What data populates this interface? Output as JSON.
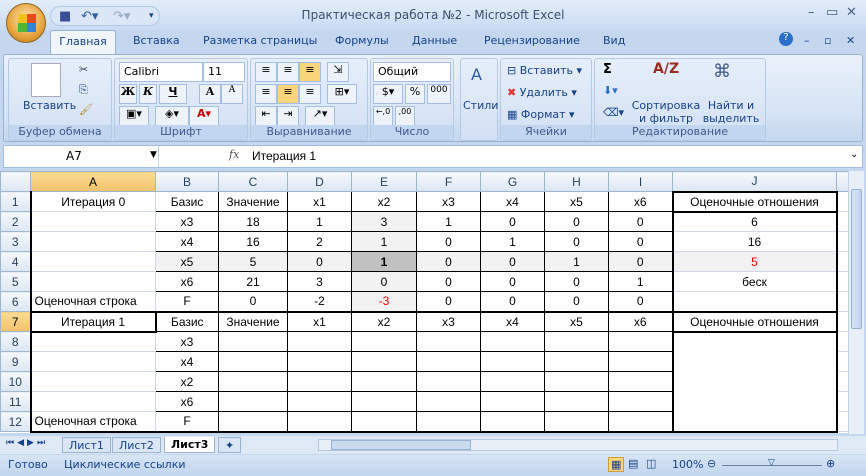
{
  "window": {
    "title": "Практическая работа №2 - Microsoft Excel"
  },
  "tabs": [
    "Главная",
    "Вставка",
    "Разметка страницы",
    "Формулы",
    "Данные",
    "Рецензирование",
    "Вид"
  ],
  "ribbon": {
    "clipboard": {
      "paste": "Вставить",
      "label": "Буфер обмена"
    },
    "font": {
      "name": "Calibri",
      "size": "11",
      "bold": "Ж",
      "italic": "К",
      "underline": "Ч",
      "grow": "A",
      "shrink": "A",
      "label": "Шрифт"
    },
    "alignment": {
      "label": "Выравнивание"
    },
    "number": {
      "format": "Общий",
      "percent": "%",
      "thousands": "000",
      "label": "Число"
    },
    "styles": {
      "label": "Стили"
    },
    "cells": {
      "insert": "Вставить",
      "delete": "Удалить",
      "format": "Формат",
      "label": "Ячейки"
    },
    "editing": {
      "sum": "Σ",
      "sort": "Сортировка и фильтр",
      "find": "Найти и выделить",
      "label": "Редактирование"
    }
  },
  "formula_bar": {
    "name_box": "A7",
    "fx": "fx",
    "value": "Итерация 1"
  },
  "columns": [
    "A",
    "B",
    "C",
    "D",
    "E",
    "F",
    "G",
    "H",
    "I",
    "J"
  ],
  "selected_cell": "A7",
  "rows": [
    [
      "Итерация 0",
      "Базис",
      "Значение",
      "x1",
      "x2",
      "x3",
      "x4",
      "x5",
      "x6",
      "Оценочные отношения"
    ],
    [
      "",
      "x3",
      "18",
      "1",
      "3",
      "1",
      "0",
      "0",
      "0",
      "6"
    ],
    [
      "",
      "x4",
      "16",
      "2",
      "1",
      "0",
      "1",
      "0",
      "0",
      "16"
    ],
    [
      "",
      "x5",
      "5",
      "0",
      "1",
      "0",
      "0",
      "1",
      "0",
      "5"
    ],
    [
      "",
      "x6",
      "21",
      "3",
      "0",
      "0",
      "0",
      "0",
      "1",
      "беск"
    ],
    [
      "Оценочная строка",
      "F",
      "0",
      "-2",
      "-3",
      "0",
      "0",
      "0",
      "0",
      ""
    ],
    [
      "Итерация 1",
      "Базис",
      "Значение",
      "x1",
      "x2",
      "x3",
      "x4",
      "x5",
      "x6",
      "Оценочные отношения"
    ],
    [
      "",
      "x3",
      "",
      "",
      "",
      "",
      "",
      "",
      "",
      ""
    ],
    [
      "",
      "x4",
      "",
      "",
      "",
      "",
      "",
      "",
      "",
      ""
    ],
    [
      "",
      "x2",
      "",
      "",
      "",
      "",
      "",
      "",
      "",
      ""
    ],
    [
      "",
      "x6",
      "",
      "",
      "",
      "",
      "",
      "",
      "",
      ""
    ],
    [
      "Оценочная строка",
      "F",
      "",
      "",
      "",
      "",
      "",
      "",
      "",
      ""
    ]
  ],
  "colors": {
    "pivot_column": "#f2f2f2",
    "pivot_cell": "#c0c0c0",
    "highlight_text": "#ff0000"
  },
  "sheets": [
    "Лист1",
    "Лист2",
    "Лист3"
  ],
  "active_sheet": "Лист3",
  "status": {
    "ready": "Готово",
    "circular": "Циклические ссылки",
    "zoom": "100%"
  }
}
